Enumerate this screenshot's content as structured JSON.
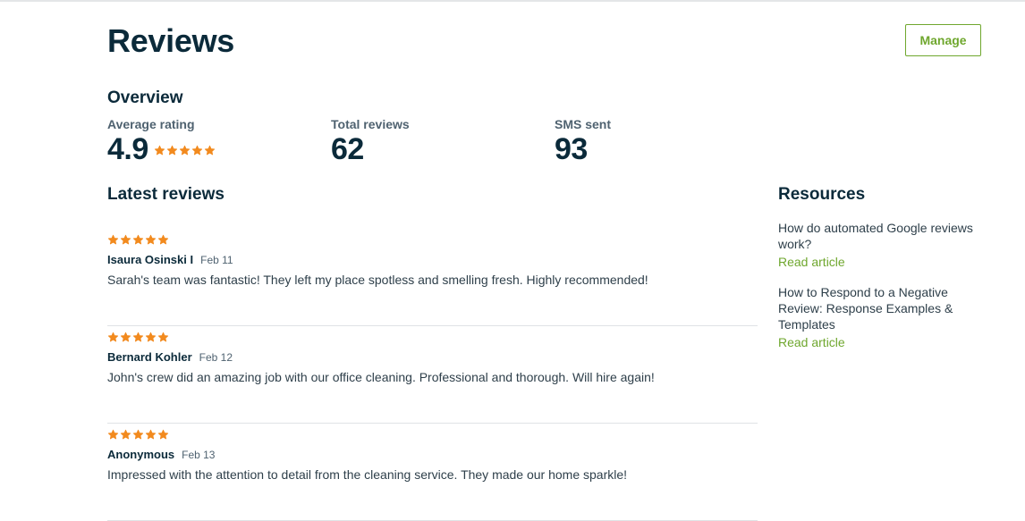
{
  "header": {
    "title": "Reviews",
    "manage_label": "Manage"
  },
  "overview": {
    "title": "Overview",
    "average_rating": {
      "label": "Average rating",
      "value": "4.9",
      "stars": 4.9
    },
    "total_reviews": {
      "label": "Total reviews",
      "value": "62"
    },
    "sms_sent": {
      "label": "SMS sent",
      "value": "93"
    }
  },
  "latest_reviews": {
    "title": "Latest reviews",
    "items": [
      {
        "stars": 5,
        "author": "Isaura Osinski I",
        "date": "Feb 11",
        "text": "Sarah's team was fantastic! They left my place spotless and smelling fresh. Highly recommended!"
      },
      {
        "stars": 5,
        "author": "Bernard Kohler",
        "date": "Feb 12",
        "text": "John's crew did an amazing job with our office cleaning. Professional and thorough. Will hire again!"
      },
      {
        "stars": 5,
        "author": "Anonymous",
        "date": "Feb 13",
        "text": "Impressed with the attention to detail from the cleaning service. They made our home sparkle!"
      }
    ]
  },
  "resources": {
    "title": "Resources",
    "items": [
      {
        "title": "How do automated Google reviews work?",
        "link_label": "Read article"
      },
      {
        "title": "How to Respond to a Negative Review: Response Examples & Templates",
        "link_label": "Read article"
      }
    ]
  },
  "colors": {
    "star": "#f28a1e",
    "accent_green": "#6fa72e",
    "heading": "#0b2a3a",
    "divider": "#dfe2e5"
  }
}
